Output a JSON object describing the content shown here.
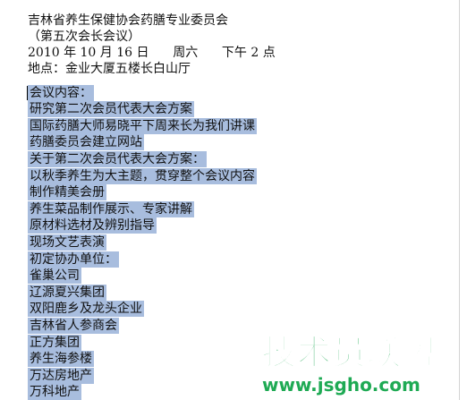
{
  "document": {
    "header": {
      "title": "吉林省养生保健协会药膳专业委员会",
      "subtitle": "（第五次会长会议）",
      "date_line": "2010 年 10 月 16 日      周六      下午 2 点",
      "location_line": "地点：金业大厦五楼长白山厅"
    },
    "selected_lines": [
      "会议内容：",
      "研究第二次会员代表大会方案",
      "国际药膳大师易晓平下周来长为我们讲课",
      "药膳委员会建立网站",
      "关于第二次会员代表大会方案：",
      "以秋季养生为大主题，贯穿整个会议内容",
      "制作精美会册",
      "养生菜品制作展示、专家讲解",
      "原材料选材及辨别指导",
      "现场文艺表演",
      "初定协办单位：",
      "雀巢公司",
      "辽源夏兴集团",
      "双阳鹿乡及龙头企业",
      "吉林省人参商会",
      "正方集团",
      "养生海参楼",
      "万达房地产",
      "万科地产"
    ],
    "selection_color": "#a8bdde"
  },
  "watermark": {
    "text": "技术员联盟",
    "url": "www.jsgho.com",
    "color": "#1faa54"
  }
}
